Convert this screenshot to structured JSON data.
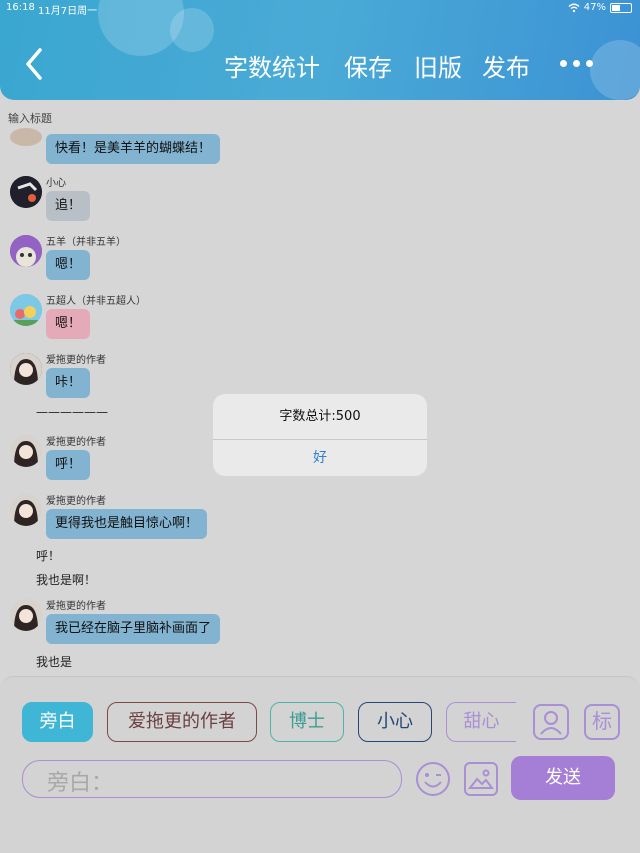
{
  "status_bar": {
    "time": "16:18",
    "date": "11月7日周一",
    "battery": "47%",
    "battery_level": 0.47
  },
  "header": {
    "nav_items": [
      "字数统计",
      "保存",
      "旧版",
      "发布"
    ]
  },
  "title_placeholder": "输入标题",
  "messages": [
    {
      "type": "bubble",
      "name": "",
      "text": "快看！是美羊羊的蝴蝶结！",
      "color": "#82b3d0"
    },
    {
      "type": "bubble",
      "name": "小心",
      "text": "追！",
      "color": "#b9bfc6"
    },
    {
      "type": "bubble",
      "name": "五羊（并非五羊）",
      "text": "嗯！",
      "color": "#82b3d0"
    },
    {
      "type": "bubble",
      "name": "五超人（并非五超人）",
      "text": "嗯！",
      "color": "#e4aab8"
    },
    {
      "type": "bubble",
      "name": "爱拖更的作者",
      "text": "咔！",
      "color": "#82b3d0"
    },
    {
      "type": "plain",
      "text": "——————"
    },
    {
      "type": "bubble",
      "name": "爱拖更的作者",
      "text": "呼！",
      "color": "#82b3d0"
    },
    {
      "type": "bubble",
      "name": "爱拖更的作者",
      "text": "更得我也是触目惊心啊！",
      "color": "#82b3d0"
    },
    {
      "type": "plain",
      "text": "呼！"
    },
    {
      "type": "plain",
      "text": "我也是啊！"
    },
    {
      "type": "bubble",
      "name": "爱拖更的作者",
      "text": "我已经在脑子里脑补画面了",
      "color": "#82b3d0"
    },
    {
      "type": "plain",
      "text": "我也是"
    }
  ],
  "alert": {
    "message": "字数总计:500",
    "ok_label": "好"
  },
  "roles": [
    {
      "label": "旁白",
      "active": true,
      "color": "#3fb6d6"
    },
    {
      "label": "爱拖更的作者",
      "active": false,
      "color": "#7a4a4a"
    },
    {
      "label": "博士",
      "active": false,
      "color": "#4fb3a8"
    },
    {
      "label": "小心",
      "active": false,
      "color": "#27457a"
    },
    {
      "label": "甜心",
      "active": false,
      "color": "#a98fd4"
    }
  ],
  "tag_button_label": "标",
  "input": {
    "placeholder": "旁白："
  },
  "send_label": "发送",
  "colors": {
    "accent": "#a57fd6",
    "header": "#3aa7d0",
    "link": "#2f7fd6"
  }
}
